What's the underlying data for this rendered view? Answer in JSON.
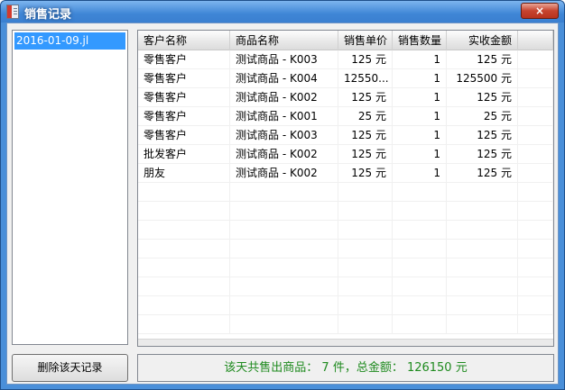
{
  "window": {
    "title": "销售记录",
    "close_label": "×"
  },
  "files": {
    "items": [
      "2016-01-09.jl"
    ],
    "selected": "2016-01-09.jl"
  },
  "table": {
    "columns": [
      "客户名称",
      "商品名称",
      "销售单价",
      "销售数量",
      "实收金额"
    ],
    "rows": [
      [
        "零售客户",
        "测试商品 - K003",
        "125 元",
        "1",
        "125 元"
      ],
      [
        "零售客户",
        "测试商品 - K004",
        "12550...",
        "1",
        "125500 元"
      ],
      [
        "零售客户",
        "测试商品 - K002",
        "125 元",
        "1",
        "125 元"
      ],
      [
        "零售客户",
        "测试商品 - K001",
        "25 元",
        "1",
        "25 元"
      ],
      [
        "零售客户",
        "测试商品 - K003",
        "125 元",
        "1",
        "125 元"
      ],
      [
        "批发客户",
        "测试商品 - K002",
        "125 元",
        "1",
        "125 元"
      ],
      [
        "朋友",
        "测试商品 - K002",
        "125 元",
        "1",
        "125 元"
      ]
    ]
  },
  "actions": {
    "delete_label": "删除该天记录"
  },
  "summary": {
    "text": "该天共售出商品： 7 件，总金额： 126150 元"
  },
  "colors": {
    "title_bar": "#3f86d6",
    "selection": "#3399ff",
    "summary_text": "#1e8a1e"
  }
}
